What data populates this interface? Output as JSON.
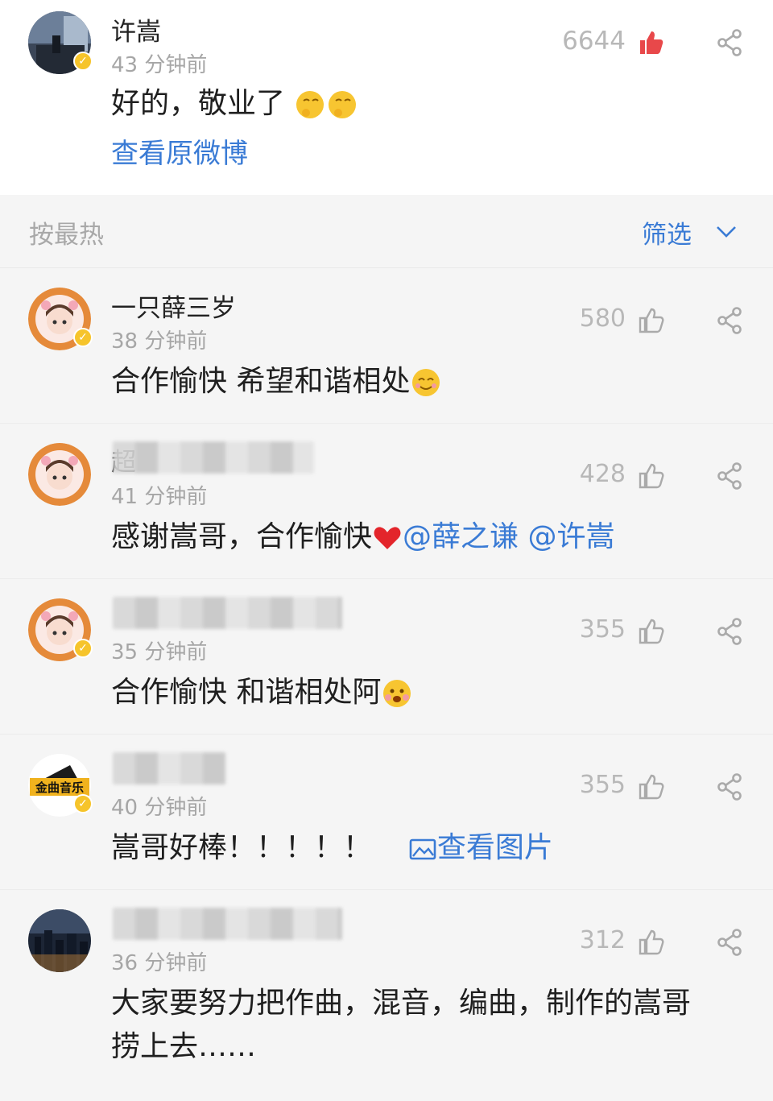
{
  "original_post": {
    "author": "许嵩",
    "time": "43 分钟前",
    "text": "好的，敬业了",
    "likes": "6644",
    "view_original": "查看原微博"
  },
  "filter_bar": {
    "sort_label": "按最热",
    "filter_label": "筛选"
  },
  "comments": [
    {
      "name": "一只薛三岁",
      "time": "38 分钟前",
      "text": "合作愉快 希望和谐相处",
      "likes": "580"
    },
    {
      "name": "超",
      "time": "41 分钟前",
      "text": "感谢嵩哥，合作愉快",
      "mention1": "@薛之谦",
      "mention2": "@许嵩",
      "likes": "428"
    },
    {
      "name": "",
      "time": "35 分钟前",
      "text": "合作愉快 和谐相处阿",
      "likes": "355"
    },
    {
      "name": "",
      "time": "40 分钟前",
      "text": "嵩哥好棒！！！！！",
      "view_image": "查看图片",
      "likes": "355",
      "avatar_text": "金曲音乐"
    },
    {
      "name": "",
      "time": "36 分钟前",
      "text_line1": "大家要努力把作曲，混音，编曲，制作的嵩哥",
      "text_line2": "捞上去……",
      "likes": "312"
    }
  ],
  "colors": {
    "link": "#3a7bd5",
    "liked": "#e8484a",
    "muted": "#a6a6a6"
  }
}
